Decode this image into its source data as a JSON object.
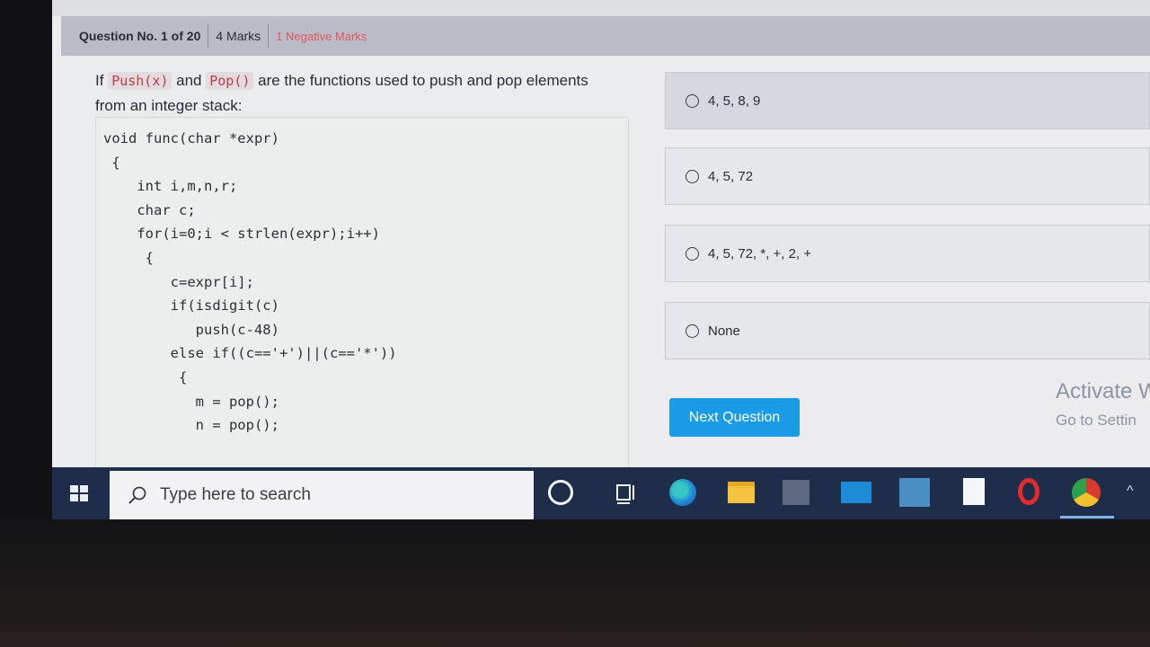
{
  "header": {
    "question_number": "Question No. 1 of 20",
    "marks": "4 Marks",
    "negative_marks": "1 Negative Marks"
  },
  "question": {
    "text_before": "If",
    "push_fn": "Push(x)",
    "text_and": "and",
    "pop_fn": "Pop()",
    "text_after": "are the functions used to push and pop elements from an integer stack:",
    "code": "void func(char *expr)\n {\n    int i,m,n,r;\n    char c;\n    for(i=0;i < strlen(expr);i++)\n     {\n        c=expr[i];\n        if(isdigit(c)\n           push(c-48)\n        else if((c=='+')||(c=='*'))\n         {\n           m = pop();\n           n = pop();"
  },
  "options": [
    {
      "label": "4, 5, 8, 9"
    },
    {
      "label": "4, 5, 72"
    },
    {
      "label": "4, 5, 72, *, +, 2, +"
    },
    {
      "label": "None"
    }
  ],
  "next_button": "Next Question",
  "watermark": {
    "title": "Activate W",
    "subtitle": "Go to Settin"
  },
  "taskbar": {
    "search_placeholder": "Type here to search",
    "icons": [
      "windows-start-icon",
      "search-icon",
      "cortana-icon",
      "task-view-icon",
      "edge-icon",
      "file-explorer-icon",
      "store-icon",
      "mail-icon",
      "photo-app-icon",
      "file-icon",
      "opera-icon",
      "chrome-icon",
      "chevron-up-icon"
    ]
  },
  "colors": {
    "header_bg": "#b9bcc6",
    "negative_marks": "#e0585c",
    "inline_code": "#c0384a",
    "button_bg": "#1a9be6",
    "taskbar_bg": "#1e2d4a"
  }
}
